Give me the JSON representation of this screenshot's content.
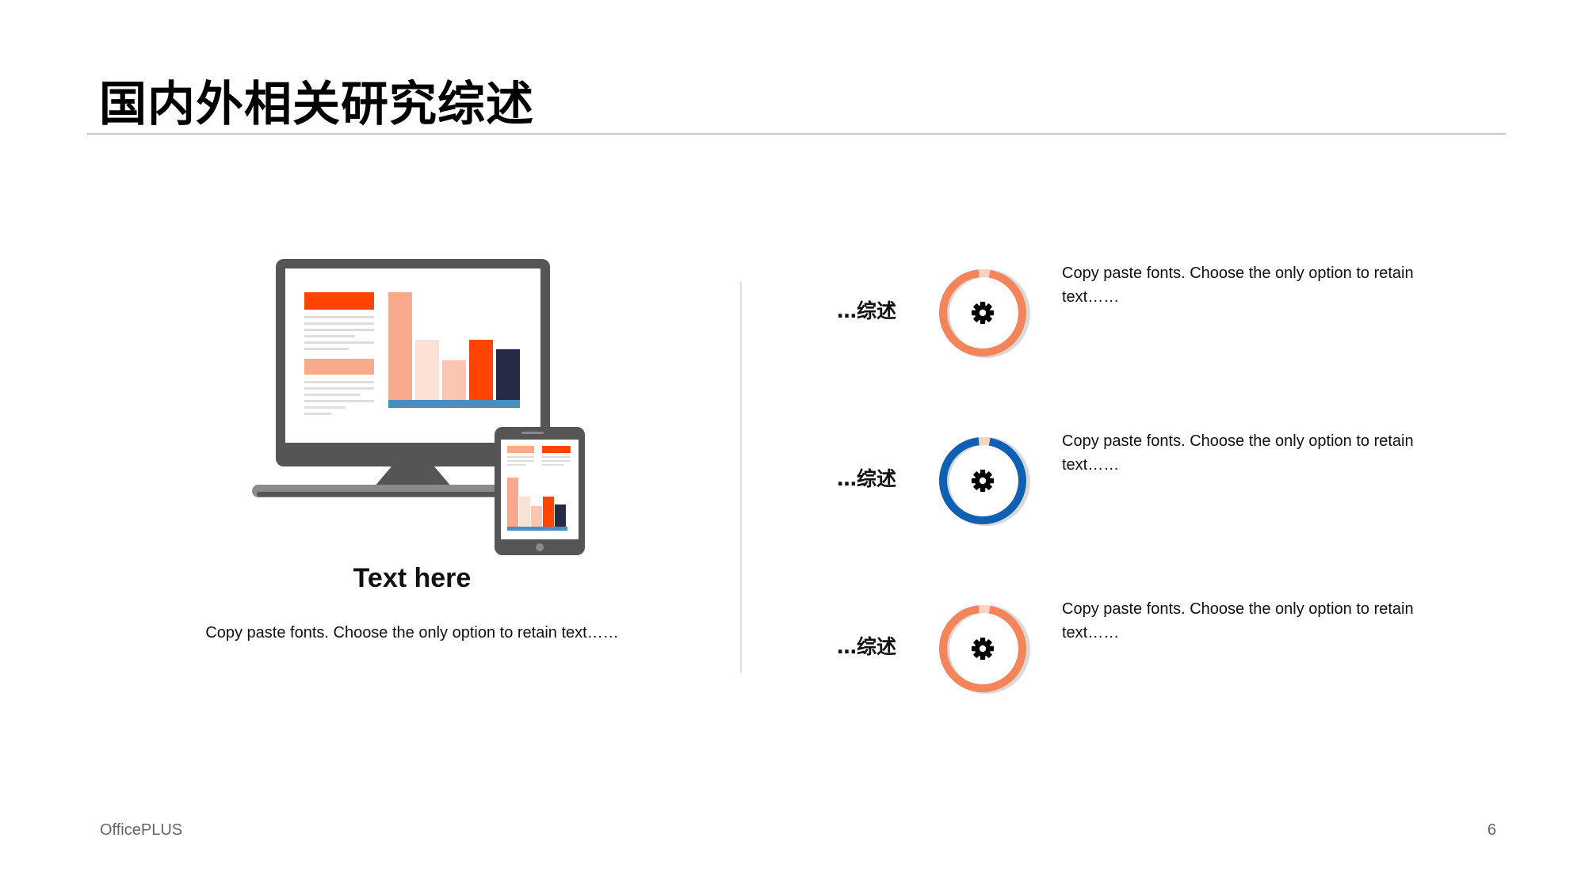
{
  "slide": {
    "title": "国内外相关研究综述"
  },
  "left_panel": {
    "heading": "Text here",
    "body": "Copy paste fonts. Choose the only option to retain text……"
  },
  "items": [
    {
      "label": "…综述",
      "icon": "gear-icon",
      "ring_color": "#F4855A",
      "description": "Copy paste fonts. Choose the only option to retain text……"
    },
    {
      "label": "…综述",
      "icon": "gear-icon",
      "ring_color": "#0F5FB2",
      "description": "Copy paste fonts. Choose the only option to retain text……"
    },
    {
      "label": "…综述",
      "icon": "gear-icon",
      "ring_color": "#F4855A",
      "description": "Copy paste fonts. Choose the only option to retain text……"
    }
  ],
  "footer": {
    "brand": "OfficePLUS",
    "page_number": "6"
  },
  "colors": {
    "accent_orange": "#F4855A",
    "accent_red": "#FF4500",
    "accent_blue": "#0F5FB2",
    "device_gray": "#555555",
    "navy": "#262A47"
  }
}
